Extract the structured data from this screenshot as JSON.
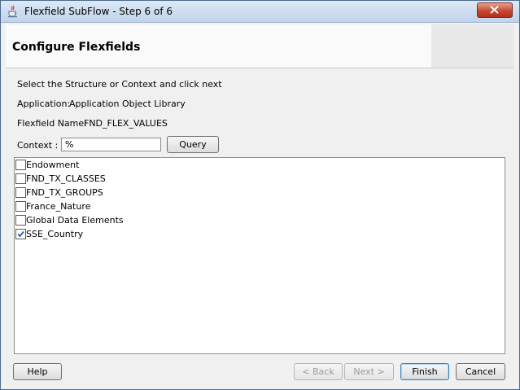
{
  "window": {
    "title": "Flexfield SubFlow - Step 6 of 6"
  },
  "header": {
    "title": "Configure Flexfields"
  },
  "form": {
    "instruction": "Select the Structure or Context and click next",
    "application_label": "Application:",
    "application_value": "Application Object Library",
    "flexfield_label": "Flexfield Name:",
    "flexfield_value": "FND_FLEX_VALUES",
    "context_label": "Context :",
    "context_value": "%",
    "query_label": "Query"
  },
  "list": {
    "items": [
      {
        "label": "Endowment",
        "checked": false
      },
      {
        "label": "FND_TX_CLASSES",
        "checked": false
      },
      {
        "label": "FND_TX_GROUPS",
        "checked": false
      },
      {
        "label": "France_Nature",
        "checked": false
      },
      {
        "label": "Global Data Elements",
        "checked": false
      },
      {
        "label": "SSE_Country",
        "checked": true
      }
    ]
  },
  "footer": {
    "help": "Help",
    "back": "< Back",
    "next": "Next >",
    "finish": "Finish",
    "cancel": "Cancel"
  },
  "colors": {
    "titlebar": "#bfd3ea",
    "close_button": "#c7472f",
    "check_mark": "#2a5ea8"
  }
}
